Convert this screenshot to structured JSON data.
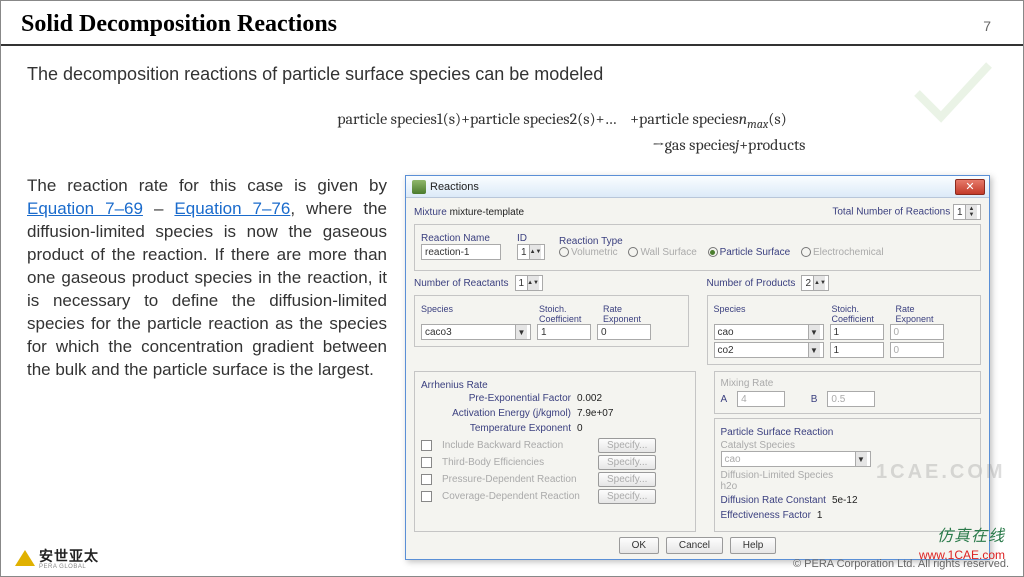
{
  "header": {
    "title": "Solid Decomposition Reactions",
    "page": "7"
  },
  "intro": "The decomposition reactions of particle surface species can be modeled",
  "equation": {
    "line1_a": "particle species1(s)+particle species2(s)+…",
    "line1_b": "+particle species",
    "line1_c": "n",
    "line1_d": "max",
    "line1_e": "(s)",
    "line2": "→gas species",
    "line2_i": "j",
    "line2_b": "+products"
  },
  "paragraph": {
    "p1": "The reaction rate for this case is given by ",
    "link1": "Equation 7–69",
    "dash": " – ",
    "link2": "Equation 7–76",
    "p2": ", where the diffusion-limited species is now the gaseous product of the reaction. If there are more than one gaseous product species in the reaction, it is necessary to define the diffusion-limited species for the particle reaction as the species for which the concentration gradient between the bulk and the particle surface is the largest."
  },
  "dialog": {
    "title": "Reactions",
    "mixture_lbl": "Mixture",
    "mixture_val": "mixture-template",
    "total_lbl": "Total Number of Reactions",
    "total_val": "1",
    "rn_lbl": "Reaction Name",
    "rn_val": "reaction-1",
    "id_lbl": "ID",
    "id_val": "1",
    "rt_lbl": "Reaction Type",
    "rt_opts": {
      "vol": "Volumetric",
      "wall": "Wall Surface",
      "part": "Particle Surface",
      "elec": "Electrochemical"
    },
    "nr_lbl": "Number of Reactants",
    "nr_val": "1",
    "np_lbl": "Number of Products",
    "np_val": "2",
    "cols": {
      "species": "Species",
      "stoich": "Stoich.\nCoefficient",
      "rate": "Rate\nExponent"
    },
    "reactant": {
      "species": "caco3",
      "stoich": "1",
      "rate": "0"
    },
    "products": [
      {
        "species": "cao",
        "stoich": "1",
        "rate": "0"
      },
      {
        "species": "co2",
        "stoich": "1",
        "rate": "0"
      }
    ],
    "arr": {
      "title": "Arrhenius Rate",
      "pre_lbl": "Pre-Exponential Factor",
      "pre_val": "0.002",
      "ae_lbl": "Activation Energy (j/kgmol)",
      "ae_val": "7.9e+07",
      "te_lbl": "Temperature Exponent",
      "te_val": "0"
    },
    "mix": {
      "title": "Mixing Rate",
      "a_lbl": "A",
      "a_val": "4",
      "b_lbl": "B",
      "b_val": "0.5"
    },
    "psr": {
      "title": "Particle Surface Reaction",
      "cat_lbl": "Catalyst Species",
      "cat_val": "cao",
      "dls_lbl": "Diffusion-Limited Species",
      "dls_val": "h2o",
      "drc_lbl": "Diffusion Rate Constant",
      "drc_val": "5e-12",
      "ef_lbl": "Effectiveness Factor",
      "ef_val": "1"
    },
    "opts": {
      "back": "Include Backward Reaction",
      "third": "Third-Body Efficiencies",
      "press": "Pressure-Dependent Reaction",
      "cov": "Coverage-Dependent Reaction",
      "spec": "Specify..."
    },
    "buttons": {
      "ok": "OK",
      "cancel": "Cancel",
      "help": "Help"
    }
  },
  "footer": {
    "logo": "安世亚太",
    "logo_sub": "PERA GLOBAL",
    "copyright": "© PERA Corporation Ltd. All rights reserved.",
    "wm1": "仿真在线",
    "wm2": "www.1CAE.com"
  }
}
